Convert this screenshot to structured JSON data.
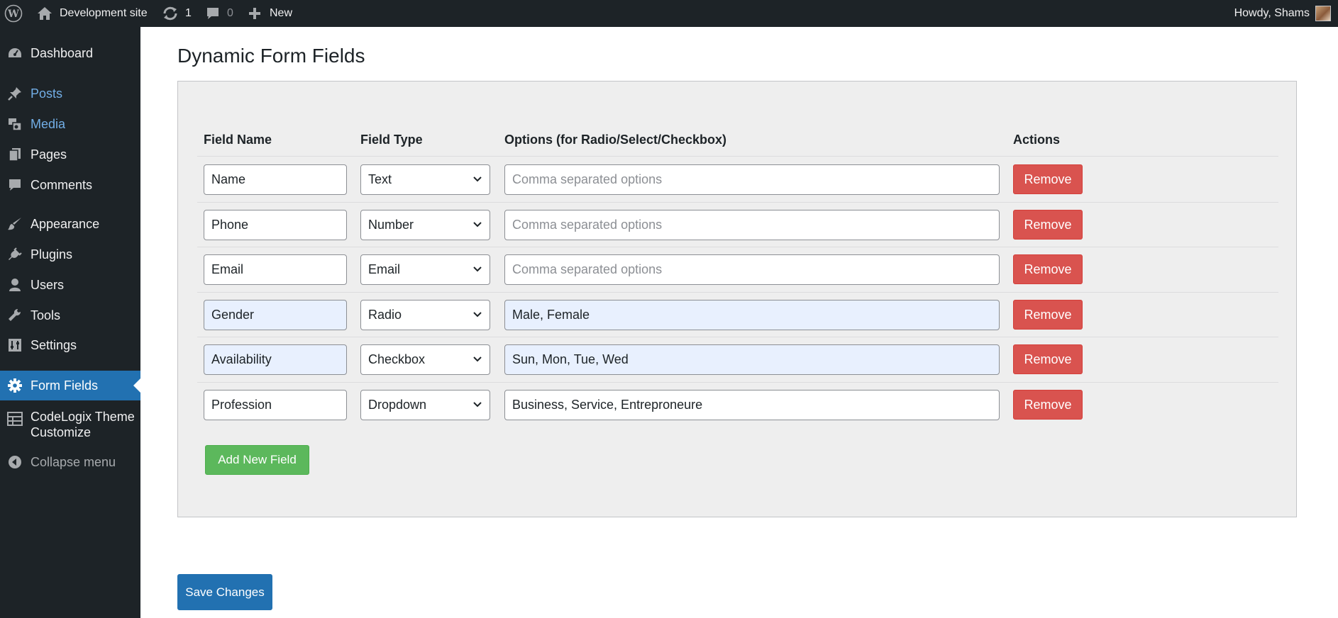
{
  "adminbar": {
    "site_name": "Development site",
    "updates_count": "1",
    "comments_count": "0",
    "new_label": "New",
    "howdy": "Howdy, Shams",
    "icons": {
      "logo": "wordpress-logo-icon",
      "site": "home-icon",
      "updates": "updates-icon",
      "comments": "comment-bubble-icon",
      "new": "plus-icon",
      "avatar": "user-avatar"
    }
  },
  "sidebar": {
    "items": [
      {
        "label": "Dashboard",
        "icon": "dashboard-icon"
      },
      {
        "label": "Posts",
        "icon": "pin-icon"
      },
      {
        "label": "Media",
        "icon": "media-icon"
      },
      {
        "label": "Pages",
        "icon": "pages-icon"
      },
      {
        "label": "Comments",
        "icon": "comment-icon"
      },
      {
        "label": "Appearance",
        "icon": "brush-icon"
      },
      {
        "label": "Plugins",
        "icon": "plugin-icon"
      },
      {
        "label": "Users",
        "icon": "user-icon"
      },
      {
        "label": "Tools",
        "icon": "wrench-icon"
      },
      {
        "label": "Settings",
        "icon": "settings-icon"
      },
      {
        "label": "Form Fields",
        "icon": "gear-icon"
      },
      {
        "label": "CodeLogix Theme",
        "label2": "Customize",
        "icon": "table-icon"
      },
      {
        "label": "Collapse menu",
        "icon": "collapse-icon"
      }
    ],
    "active_color": "#2271b1"
  },
  "main": {
    "title": "Dynamic Form Fields",
    "columns": {
      "name": "Field Name",
      "type": "Field Type",
      "options": "Options (for Radio/Select/Checkbox)",
      "actions": "Actions"
    },
    "options_placeholder": "Comma separated options",
    "rows": [
      {
        "name": "Name",
        "type": "Text",
        "options": ""
      },
      {
        "name": "Phone",
        "type": "Number",
        "options": ""
      },
      {
        "name": "Email",
        "type": "Email",
        "options": ""
      },
      {
        "name": "Gender",
        "type": "Radio",
        "options": "Male, Female"
      },
      {
        "name": "Availability",
        "type": "Checkbox",
        "options": "Sun, Mon, Tue, Wed"
      },
      {
        "name": "Profession",
        "type": "Dropdown",
        "options": "Business, Service, Entreproneure"
      }
    ],
    "remove_label": "Remove",
    "add_label": "Add New Field",
    "save_label": "Save Changes",
    "colors": {
      "remove": "#d9534f",
      "add": "#5cb85c",
      "save": "#2271b1"
    }
  }
}
